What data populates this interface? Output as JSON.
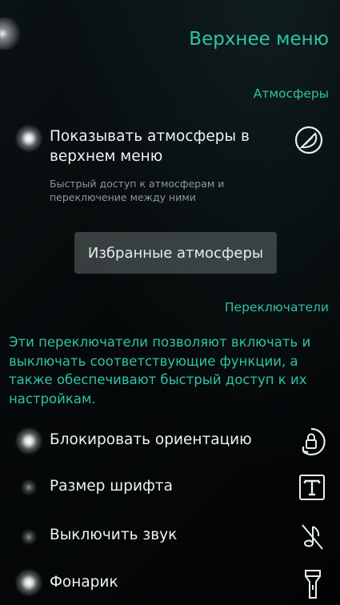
{
  "header": {
    "title": "Верхнее меню"
  },
  "atmospheres": {
    "section_title": "Атмосферы",
    "toggle": {
      "title": "Показывать атмосферы в верхнем меню",
      "description": "Быстрый доступ к атмосферам и переключение между ними",
      "enabled": true,
      "icon": "atmosphere-icon"
    },
    "favorites_button": "Избранные атмосферы"
  },
  "switches": {
    "section_title": "Переключатели",
    "description": "Эти переключатели позволяют включать и выключать соответствующие функции, а также обеспечивают быстрый доступ к их настройкам.",
    "items": [
      {
        "label": "Блокировать ориентацию",
        "enabled": true,
        "icon": "orientation-lock-icon"
      },
      {
        "label": "Размер шрифта",
        "enabled": false,
        "icon": "font-size-icon"
      },
      {
        "label": "Выключить звук",
        "enabled": false,
        "icon": "mute-icon"
      },
      {
        "label": "Фонарик",
        "enabled": true,
        "icon": "flashlight-icon"
      }
    ]
  },
  "colors": {
    "accent": "#2fc3a5",
    "background": "#040607",
    "text": "#eef2f2",
    "secondary_text": "#8c9a9a"
  }
}
